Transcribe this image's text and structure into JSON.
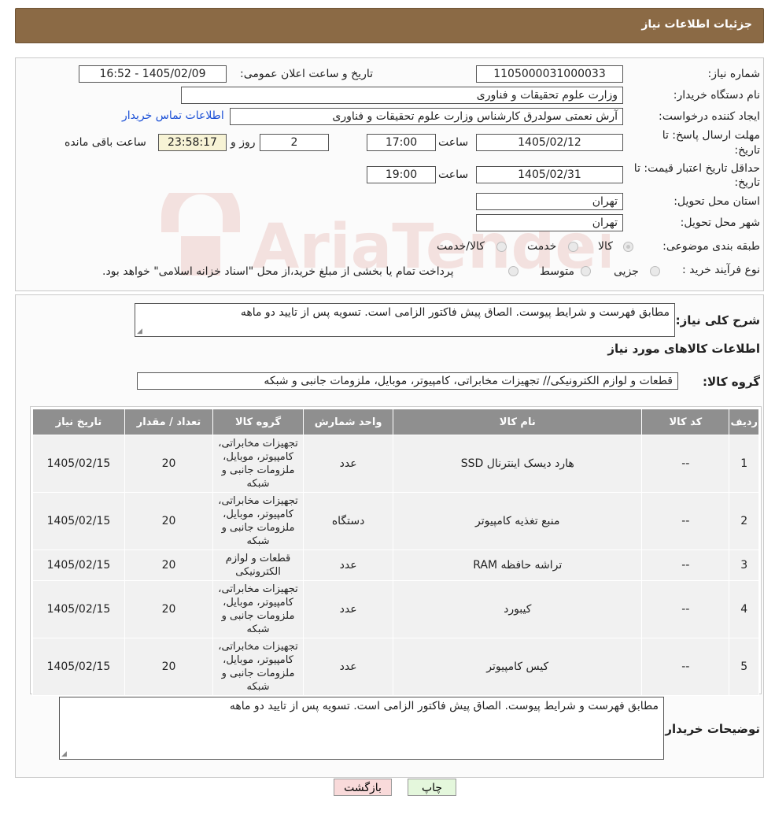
{
  "header": {
    "title": "جزئیات اطلاعات نیاز"
  },
  "form": {
    "need_number": {
      "label": "شماره نیاز:",
      "value": "1105000031000033"
    },
    "announce": {
      "label": "تاریخ و ساعت اعلان عمومی:",
      "value": "1405/02/09 - 16:52"
    },
    "buyer": {
      "label": "نام دستگاه خریدار:",
      "value": "وزارت علوم  تحقیقات و فناوری"
    },
    "creator": {
      "label": "ایجاد کننده درخواست:",
      "value": "آرش نعمتی سولدرق کارشناس وزارت علوم  تحقیقات و فناوری",
      "contact_link": "اطلاعات تماس خریدار"
    },
    "deadline": {
      "label_line1": "مهلت ارسال پاسخ: تا",
      "label_line2": "تاریخ:",
      "date": "1405/02/12",
      "time_label": "ساعت",
      "time": "17:00",
      "days": "2",
      "days_label": "روز و",
      "remaining": "23:58:17",
      "remaining_label": "ساعت باقی مانده"
    },
    "validity": {
      "label_line1": "حداقل تاریخ اعتبار قیمت: تا",
      "label_line2": "تاریخ:",
      "date": "1405/02/31",
      "time_label": "ساعت",
      "time": "19:00"
    },
    "province": {
      "label": "استان محل تحویل:",
      "value": "تهران"
    },
    "city": {
      "label": "شهر محل تحویل:",
      "value": "تهران"
    },
    "category": {
      "label": "طبقه بندی موضوعی:",
      "options": [
        "کالا",
        "خدمت",
        "کالا/خدمت"
      ],
      "selected": "کالا"
    },
    "process": {
      "label": "نوع فرآیند خرید :",
      "options": [
        "جزیی",
        "متوسط"
      ],
      "note": "پرداخت تمام یا بخشی از مبلغ خرید،از محل \"اسناد خزانه اسلامی\" خواهد بود."
    }
  },
  "summary": {
    "label": "شرح کلی نیاز:",
    "value": "مطابق فهرست و شرایط پیوست. الصاق پیش فاکتور الزامی است. تسویه پس از تایید دو ماهه"
  },
  "goods_section_title": "اطلاعات کالاهای مورد نیاز",
  "goods_group": {
    "label": "گروه کالا:",
    "value": "قطعات و لوازم الکترونیکی// تجهیزات مخابراتی، کامپیوتر، موبایل، ملزومات جانبی و شبکه"
  },
  "table": {
    "headers": [
      "ردیف",
      "کد کالا",
      "نام کالا",
      "واحد شمارش",
      "گروه کالا",
      "تعداد / مقدار",
      "تاریخ نیاز"
    ],
    "rows": [
      {
        "row": "1",
        "code": "--",
        "name": "هارد دیسک اینترنال SSD",
        "unit": "عدد",
        "group": "تجهیزات مخابراتی، کامپیوتر، موبایل، ملزومات جانبی و شبکه",
        "qty": "20",
        "date": "1405/02/15"
      },
      {
        "row": "2",
        "code": "--",
        "name": "منبع تغذیه کامپیوتر",
        "unit": "دستگاه",
        "group": "تجهیزات مخابراتی، کامپیوتر، موبایل، ملزومات جانبی و شبکه",
        "qty": "20",
        "date": "1405/02/15"
      },
      {
        "row": "3",
        "code": "--",
        "name": "تراشه حافظه RAM",
        "unit": "عدد",
        "group": "قطعات و لوازم الکترونیکی",
        "qty": "20",
        "date": "1405/02/15"
      },
      {
        "row": "4",
        "code": "--",
        "name": "کیبورد",
        "unit": "عدد",
        "group": "تجهیزات مخابراتی، کامپیوتر، موبایل، ملزومات جانبی و شبکه",
        "qty": "20",
        "date": "1405/02/15"
      },
      {
        "row": "5",
        "code": "--",
        "name": "کیس کامپیوتر",
        "unit": "عدد",
        "group": "تجهیزات مخابراتی، کامپیوتر، موبایل، ملزومات جانبی و شبکه",
        "qty": "20",
        "date": "1405/02/15"
      }
    ]
  },
  "buyer_notes": {
    "label": "توضیحات خریدار:",
    "value": "مطابق فهرست و شرایط پیوست. الصاق پیش فاکتور الزامی است. تسویه پس از تایید دو ماهه"
  },
  "buttons": {
    "print": "چاپ",
    "back": "بازگشت"
  },
  "watermark": {
    "text": "AriaTender.neT",
    "color": "#c0392b"
  }
}
